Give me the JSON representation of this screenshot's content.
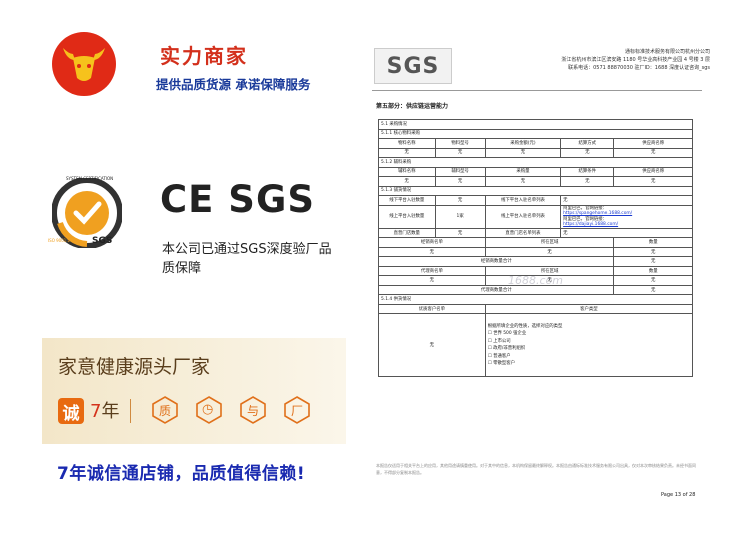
{
  "header": {
    "title": "实力商家",
    "subtitle": "提供品质货源  承诺保障服务"
  },
  "certification": {
    "seal_text_top": "SYSTEM CERTIFICATION",
    "seal_text_bottom": "ISO 9001:2000",
    "seal_brand": "SGS",
    "marks": "CE SGS",
    "statement": "本公司已通过SGS深度验厂品质保障"
  },
  "gold_panel": {
    "title": "家意健康源头厂家",
    "badge": "诚",
    "years_number": "7",
    "years_unit": "年",
    "icons": [
      {
        "name": "quality-icon",
        "glyph": "质"
      },
      {
        "name": "clock-icon",
        "glyph": "◷"
      },
      {
        "name": "return-icon",
        "glyph": "与"
      },
      {
        "name": "factory-icon",
        "glyph": "厂"
      }
    ]
  },
  "slogan": "7年诚信通店铺，品质值得信赖!",
  "document": {
    "logo": "SGS",
    "company_lines": [
      "通标标准技术服务有限公司杭州分公司",
      "浙江省杭州市滨江区滨安路 1180 号华业高科技产业园 4 号楼 3 层",
      "联系电话：0571 88870030    驻厂ID：1688 深度认证咨询_sgs"
    ],
    "section_title": "第五部分：供应链运营能力",
    "table": {
      "header": "5.1 采购情况",
      "s511": "5.1.1 核心物料采购",
      "core_cols": [
        "物料名称",
        "物料型号",
        "采购金额(元)",
        "结算方式",
        "供应商名称"
      ],
      "core_vals": [
        "无",
        "无",
        "无",
        "无",
        "无"
      ],
      "s512": "5.1.2 辅料采购",
      "aux_cols": [
        "辅料名称",
        "辅料型号",
        "采购量",
        "结算条件",
        "供应商名称"
      ],
      "aux_vals": [
        "无",
        "无",
        "无",
        "无",
        "无"
      ],
      "s513": "5.1.3 铺货情况",
      "r1_label": "线下平台入驻数量",
      "r1_val": "无",
      "r1_label2": "线下平台入驻名单列表",
      "r1_val2": "无",
      "r2_label": "线上平台入驻数量",
      "r2_val": "1家",
      "r2_label2": "线上平台入驻名单列表",
      "r2_links": [
        "阿里巴巴，官网链接：",
        "https://spangehome.1688.com/",
        "阿里巴巴，官网链接：",
        "https://dajiayi.1688.com/"
      ],
      "r3_label": "直营门店数量",
      "r3_val": "无",
      "r3_label2": "直营门店名单列表",
      "r3_val2": "无",
      "dist_cols": [
        "经销商名单",
        "所在区域",
        "数量"
      ],
      "dist_vals": [
        "无",
        "无",
        "无"
      ],
      "dist_total_label": "经销商数量合计",
      "dist_total_val": "无",
      "agent_cols": [
        "代理商名单",
        "所在区域",
        "数量"
      ],
      "agent_vals": [
        "无",
        "无",
        "无"
      ],
      "agent_total_label": "代理商数量合计",
      "agent_total_val": "无",
      "s514": "5.1.4 供货情况",
      "cust_cols": [
        "优质客户名单",
        "客户类型"
      ],
      "cust_name": "无",
      "cust_type_intro": "根据所填企业的性质，选择对应的类型",
      "cust_types": [
        "☐ 世界 500 强企业",
        "☐ 上市公司",
        "☐ 政府/非营利组织",
        "☐ 普通客户",
        "☐ 零散型客户"
      ]
    },
    "watermark": "1688.com",
    "footer": "本报告仅适用于相关平台上的应用，其他用途请慎重使用。对于其中的信息，本机构保留最终解释权。本报告由通标标准技术服务有限公司出具，仅对本次审核结果负责。未经书面同意，不得部分复制本报告。",
    "page": "Page 13 of 28"
  }
}
